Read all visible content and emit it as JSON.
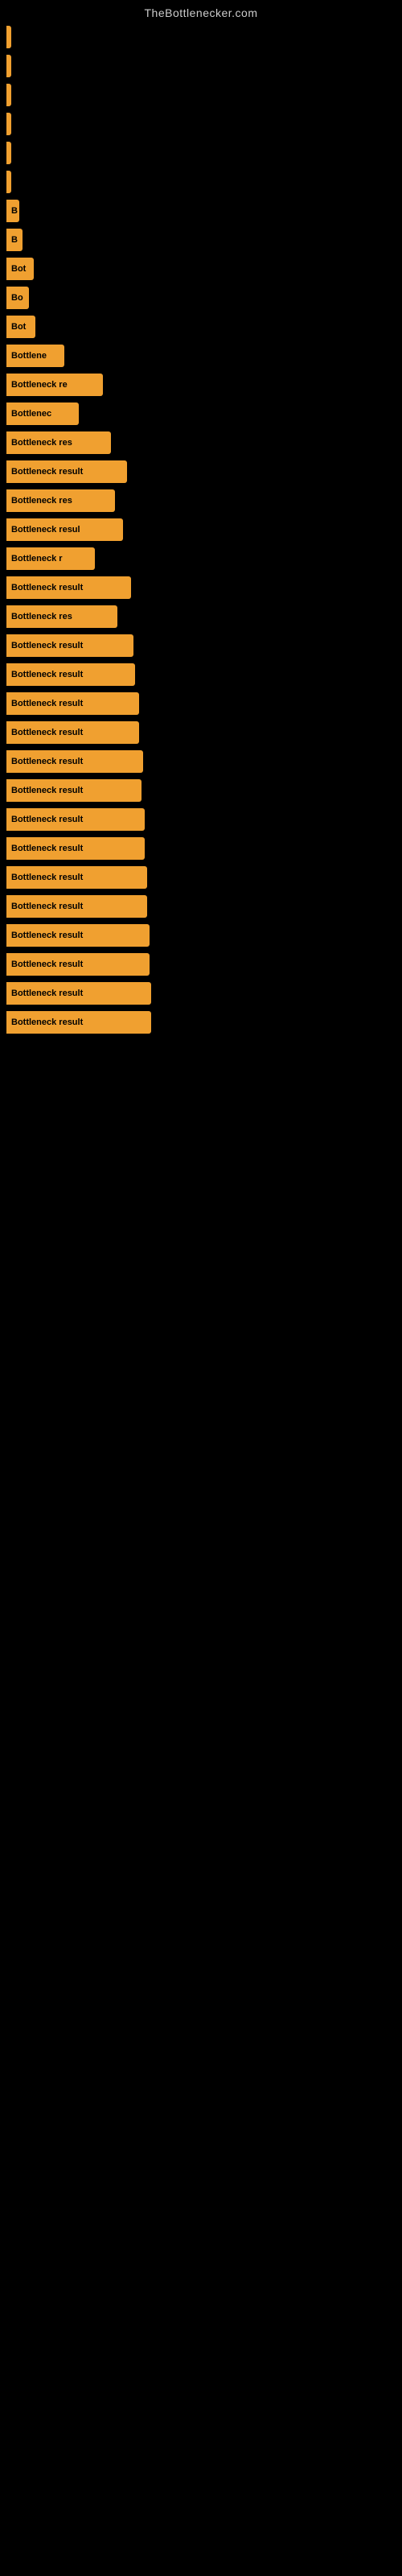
{
  "site_title": "TheBottlenecker.com",
  "bars": [
    {
      "id": 1,
      "label": "",
      "width": 4
    },
    {
      "id": 2,
      "label": "",
      "width": 4
    },
    {
      "id": 3,
      "label": "",
      "width": 6
    },
    {
      "id": 4,
      "label": "",
      "width": 4
    },
    {
      "id": 5,
      "label": "",
      "width": 4
    },
    {
      "id": 6,
      "label": "",
      "width": 6
    },
    {
      "id": 7,
      "label": "B",
      "width": 16
    },
    {
      "id": 8,
      "label": "B",
      "width": 20
    },
    {
      "id": 9,
      "label": "Bot",
      "width": 34
    },
    {
      "id": 10,
      "label": "Bo",
      "width": 28
    },
    {
      "id": 11,
      "label": "Bot",
      "width": 36
    },
    {
      "id": 12,
      "label": "Bottlene",
      "width": 72
    },
    {
      "id": 13,
      "label": "Bottleneck re",
      "width": 120
    },
    {
      "id": 14,
      "label": "Bottlenec",
      "width": 90
    },
    {
      "id": 15,
      "label": "Bottleneck res",
      "width": 130
    },
    {
      "id": 16,
      "label": "Bottleneck result",
      "width": 150
    },
    {
      "id": 17,
      "label": "Bottleneck res",
      "width": 135
    },
    {
      "id": 18,
      "label": "Bottleneck resul",
      "width": 145
    },
    {
      "id": 19,
      "label": "Bottleneck r",
      "width": 110
    },
    {
      "id": 20,
      "label": "Bottleneck result",
      "width": 155
    },
    {
      "id": 21,
      "label": "Bottleneck res",
      "width": 138
    },
    {
      "id": 22,
      "label": "Bottleneck result",
      "width": 158
    },
    {
      "id": 23,
      "label": "Bottleneck result",
      "width": 160
    },
    {
      "id": 24,
      "label": "Bottleneck result",
      "width": 165
    },
    {
      "id": 25,
      "label": "Bottleneck result",
      "width": 165
    },
    {
      "id": 26,
      "label": "Bottleneck result",
      "width": 170
    },
    {
      "id": 27,
      "label": "Bottleneck result",
      "width": 168
    },
    {
      "id": 28,
      "label": "Bottleneck result",
      "width": 172
    },
    {
      "id": 29,
      "label": "Bottleneck result",
      "width": 172
    },
    {
      "id": 30,
      "label": "Bottleneck result",
      "width": 175
    },
    {
      "id": 31,
      "label": "Bottleneck result",
      "width": 175
    },
    {
      "id": 32,
      "label": "Bottleneck result",
      "width": 178
    },
    {
      "id": 33,
      "label": "Bottleneck result",
      "width": 178
    },
    {
      "id": 34,
      "label": "Bottleneck result",
      "width": 180
    },
    {
      "id": 35,
      "label": "Bottleneck result",
      "width": 180
    }
  ]
}
